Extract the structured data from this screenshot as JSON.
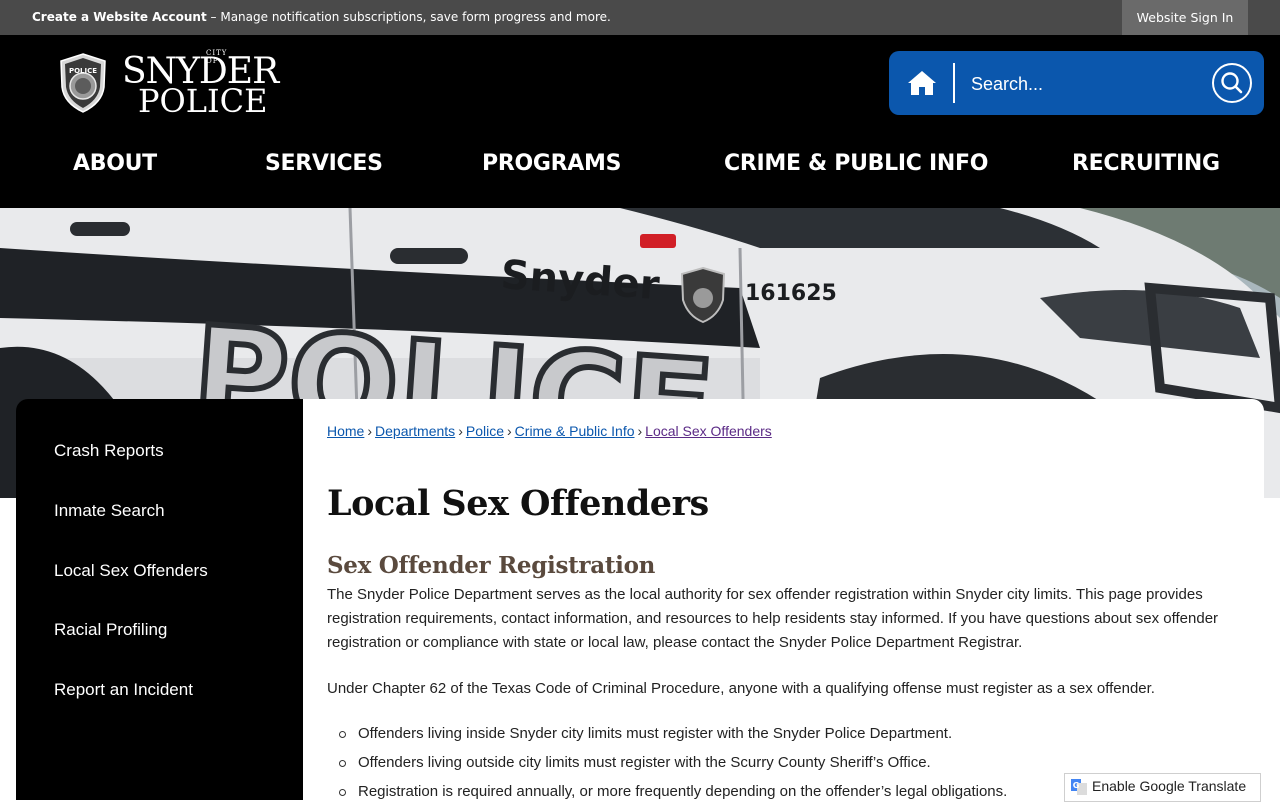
{
  "topbar": {
    "create_account": "Create a Website Account",
    "message": " – Manage notification subscriptions, save form progress and more.",
    "sign_in": "Website Sign In"
  },
  "logo": {
    "city_of": "CITY OF",
    "line1": "SNYDER",
    "line2": "POLICE",
    "badge_text": "POLICE"
  },
  "search": {
    "placeholder": "Search..."
  },
  "nav": {
    "items": [
      "ABOUT",
      "SERVICES",
      "PROGRAMS",
      "CRIME & PUBLIC INFO",
      "RECRUITING"
    ]
  },
  "hero": {
    "door_text": "Snyder",
    "unit_number": "161625",
    "big_text": "POLICE"
  },
  "sidebar": {
    "items": [
      "Crash Reports",
      "Inmate Search",
      "Local Sex Offenders",
      "Racial Profiling",
      "Report an Incident"
    ]
  },
  "breadcrumb": {
    "items": [
      "Home",
      "Departments",
      "Police",
      "Crime & Public Info",
      "Local Sex Offenders"
    ],
    "separator": "›"
  },
  "main": {
    "title": "Local Sex Offenders",
    "section_title": "Sex Offender Registration",
    "paragraph1": "The Snyder Police Department serves as the local authority for sex offender registration within Snyder city limits. This page provides registration requirements, contact information, and resources to help residents stay informed. If you have questions about sex offender registration or compliance with state or local law, please contact the Snyder Police Department Registrar.",
    "paragraph2": "Under Chapter 62 of the Texas Code of Criminal Procedure, anyone with a qualifying offense must register as a sex offender.",
    "bullets": [
      "Offenders living inside Snyder city limits must register with the Snyder Police Department.",
      "Offenders living outside city limits must register with the Scurry County Sheriff’s Office.",
      "Registration is required annually, or more frequently depending on the offender’s legal obligations."
    ]
  },
  "translate": {
    "label": "Enable Google Translate"
  },
  "colors": {
    "header_bg": "#000000",
    "topbar_bg": "#4a4a4a",
    "search_bg": "#0b57ad",
    "link": "#0b57ad",
    "section_title": "#5a4a3e"
  }
}
